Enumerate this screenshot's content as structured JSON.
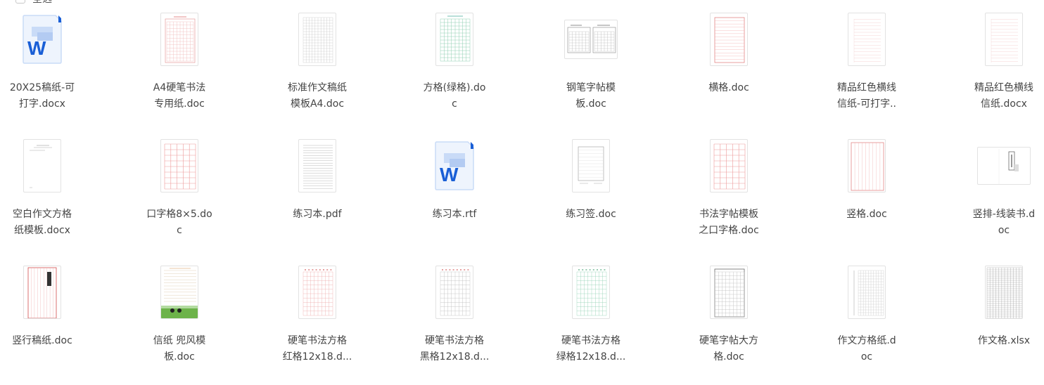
{
  "header": {
    "select_all_label": "全选"
  },
  "files": [
    {
      "id": "f1",
      "thumb": "word-icon",
      "line1": "20X25稿纸-可",
      "line2": "打字.docx"
    },
    {
      "id": "f2",
      "thumb": "red-grid-small",
      "line1": "A4硬笔书法",
      "line2": "专用纸.doc"
    },
    {
      "id": "f3",
      "thumb": "gray-grid",
      "line1": "标准作文稿纸",
      "line2": "模板A4.doc"
    },
    {
      "id": "f4",
      "thumb": "green-grid",
      "line1": "方格(绿格).do",
      "line2": "c"
    },
    {
      "id": "f5",
      "thumb": "pen-copybook",
      "line1": "钢笔字帖模",
      "line2": "板.doc"
    },
    {
      "id": "f6",
      "thumb": "red-lines",
      "line1": "横格.doc",
      "line2": ""
    },
    {
      "id": "f7",
      "thumb": "faint-lines",
      "line1": "精品红色横线",
      "line2": "信纸-可打字.."
    },
    {
      "id": "f8",
      "thumb": "faint-lines",
      "line1": "精品红色横线",
      "line2": "信纸.docx"
    },
    {
      "id": "f9",
      "thumb": "blank-essay",
      "line1": "空白作文方格",
      "line2": "纸模板.docx"
    },
    {
      "id": "f10",
      "thumb": "red-big-grid",
      "line1": "口字格8×5.do",
      "line2": "c"
    },
    {
      "id": "f11",
      "thumb": "gray-lines",
      "line1": "练习本.pdf",
      "line2": ""
    },
    {
      "id": "f12",
      "thumb": "word-icon",
      "line1": "练习本.rtf",
      "line2": ""
    },
    {
      "id": "f13",
      "thumb": "practice-sign",
      "line1": "练习签.doc",
      "line2": ""
    },
    {
      "id": "f14",
      "thumb": "red-big-grid",
      "line1": "书法字帖模板",
      "line2": "之口字格.doc"
    },
    {
      "id": "f15",
      "thumb": "vertical-lines",
      "line1": "竖格.doc",
      "line2": ""
    },
    {
      "id": "f16",
      "thumb": "thread-book",
      "line1": "竖排-线装书.d",
      "line2": "oc"
    },
    {
      "id": "f17",
      "thumb": "vertical-draft",
      "line1": "竖行稿纸.doc",
      "line2": ""
    },
    {
      "id": "f18",
      "thumb": "letter-paper",
      "line1": "信纸 兜风模",
      "line2": "板.doc"
    },
    {
      "id": "f19",
      "thumb": "red-char-grid",
      "line1": "硬笔书法方格",
      "line2": "红格12x18.d..."
    },
    {
      "id": "f20",
      "thumb": "black-char-grid",
      "line1": "硬笔书法方格",
      "line2": "黑格12x18.d..."
    },
    {
      "id": "f21",
      "thumb": "green-char-grid",
      "line1": "硬笔书法方格",
      "line2": "绿格12x18.d..."
    },
    {
      "id": "f22",
      "thumb": "big-square",
      "line1": "硬笔字帖大方",
      "line2": "格.doc"
    },
    {
      "id": "f23",
      "thumb": "essay-grid",
      "line1": "作文方格纸.d",
      "line2": "oc"
    },
    {
      "id": "f24",
      "thumb": "spreadsheet",
      "line1": "作文格.xlsx",
      "line2": ""
    }
  ],
  "colors": {
    "word_blue": "#1a5fd6",
    "word_light": "#c9dbf7",
    "red_line": "#e38b8b",
    "green_line": "#8fcfb1",
    "gray_line": "#c8c8c8"
  }
}
